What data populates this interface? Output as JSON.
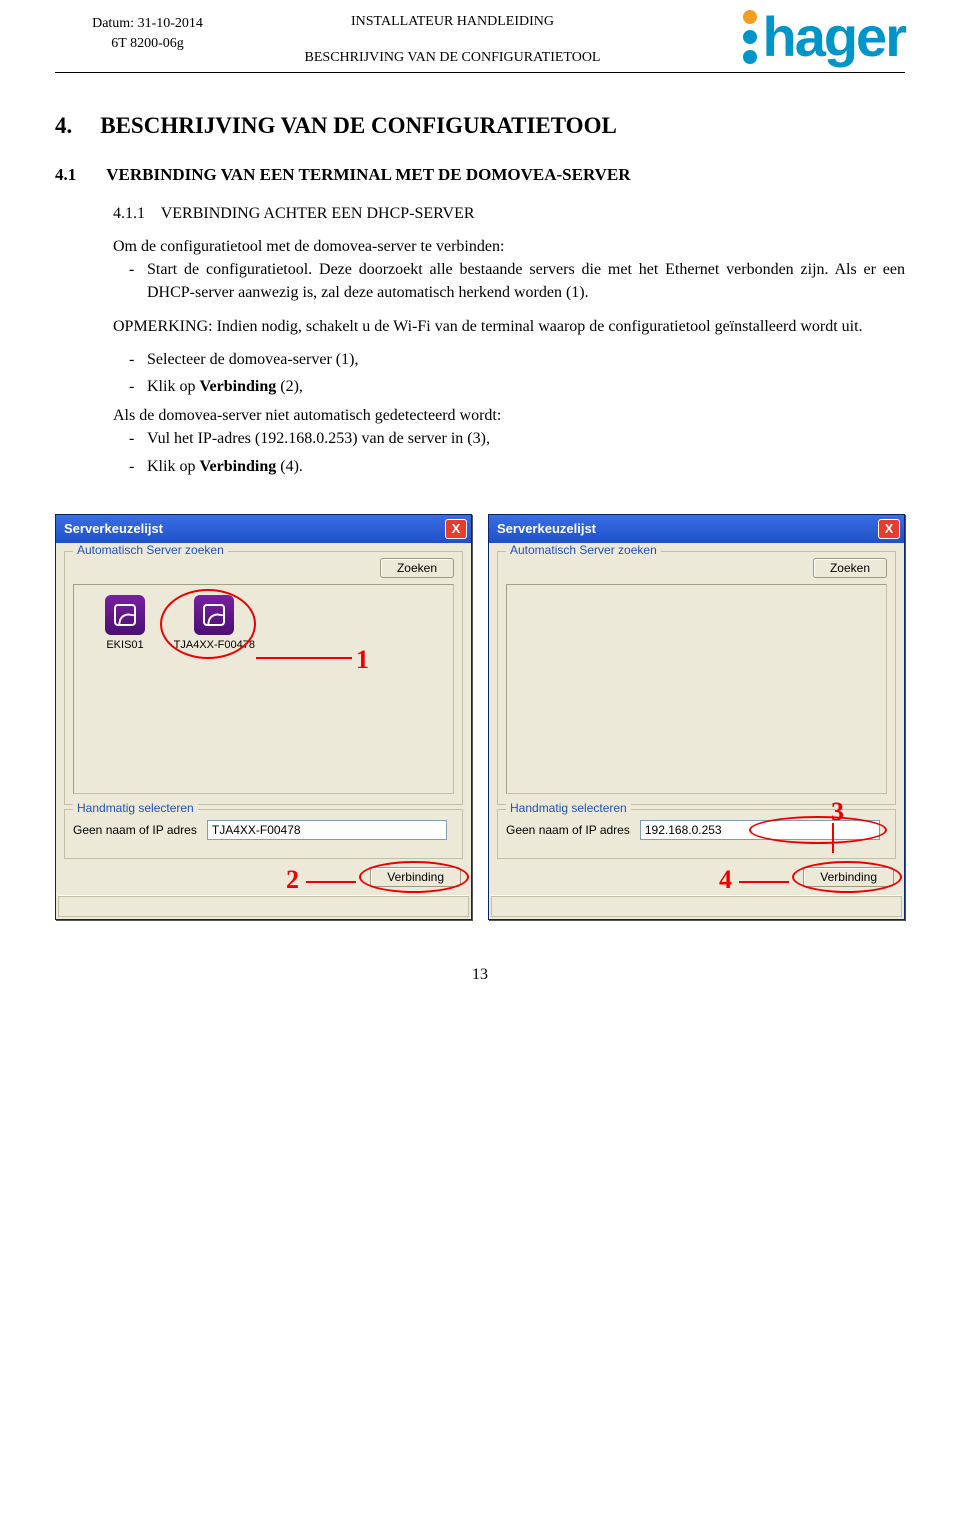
{
  "header": {
    "date_label": "Datum: 31-10-2014",
    "doc_code": "6T 8200-06g",
    "title1": "INSTALLATEUR HANDLEIDING",
    "title2": "BESCHRIJVING VAN DE CONFIGURATIETOOL",
    "brand": "hager"
  },
  "h1": {
    "num": "4.",
    "text": "BESCHRIJVING VAN DE CONFIGURATIETOOL"
  },
  "h2": {
    "num": "4.1",
    "text": "VERBINDING VAN EEN TERMINAL MET DE DOMOVEA-SERVER"
  },
  "h3": {
    "num": "4.1.1",
    "text": "VERBINDING ACHTER EEN DHCP-SERVER"
  },
  "para1": "Om de configuratietool met de domovea-server te verbinden:",
  "bullet1": "Start de configuratietool. Deze doorzoekt alle bestaande servers die met het Ethernet verbonden zijn. Als er een DHCP-server aanwezig is, zal deze automatisch herkend worden (1).",
  "note_label": "OPMERKING:",
  "note_text": "Indien nodig, schakelt u de Wi-Fi van de terminal waarop de configuratietool geïnstalleerd wordt uit.",
  "bullet2": "Selecteer de domovea-server (1),",
  "bullet3": "Klik op Verbinding (2),",
  "para2": "Als de domovea-server niet automatisch gedetecteerd wordt:",
  "bullet4": "Vul het IP-adres (192.168.0.253) van de server in (3),",
  "bullet5": "Klik op Verbinding (4).",
  "win": {
    "title": "Serverkeuzelijst",
    "close": "X",
    "auto_title": "Automatisch Server zoeken",
    "search_btn": "Zoeken",
    "manual_title": "Handmatig selecteren",
    "ip_label": "Geen naam of IP adres",
    "connect_btn": "Verbinding"
  },
  "left": {
    "server1": "EKIS01",
    "server2": "TJA4XX-F00478",
    "ip_value": "TJA4XX-F00478",
    "callout1": "1",
    "callout2": "2"
  },
  "right": {
    "ip_value": "192.168.0.253",
    "callout3": "3",
    "callout4": "4"
  },
  "footer": {
    "page": "13"
  }
}
